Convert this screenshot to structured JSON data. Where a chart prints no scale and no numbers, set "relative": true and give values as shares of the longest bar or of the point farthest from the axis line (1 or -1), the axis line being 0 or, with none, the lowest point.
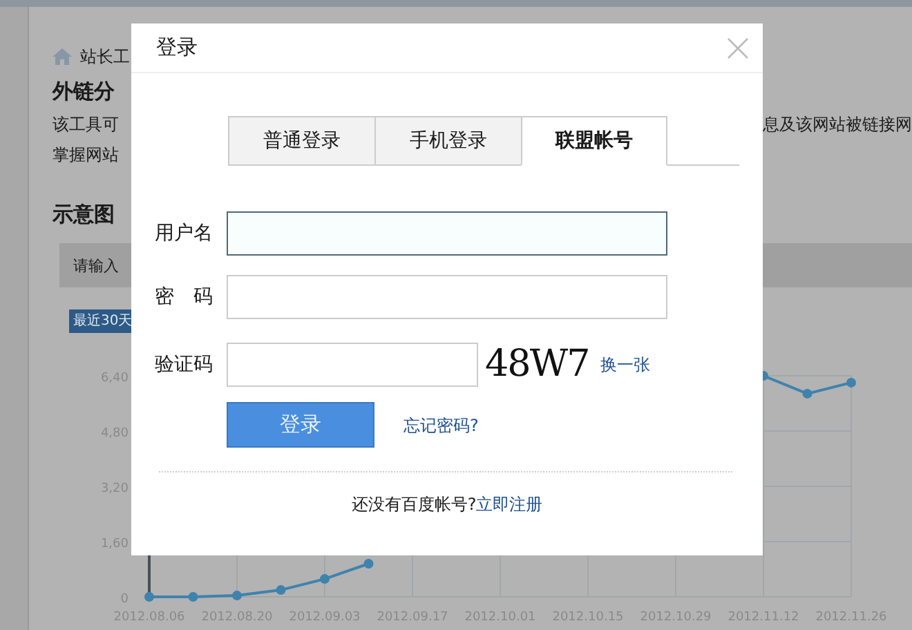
{
  "background": {
    "breadcrumb": "站长工",
    "title": "外链分",
    "description_left": [
      "该工具可",
      "掌握网站"
    ],
    "description_right": "息及该网站被链接网",
    "section_title": "示意图",
    "search_hint": "请输入",
    "range_tab": "最近30天",
    "chart_data": {
      "type": "line",
      "relative": true,
      "categories": [
        "2012.08.06",
        null,
        "2012.08.20",
        null,
        "2012.09.03",
        null,
        "2012.09.17",
        null,
        "2012.10.01",
        null,
        "2012.10.15",
        null,
        "2012.10.29",
        null,
        "2012.11.12",
        null,
        "2012.11.26"
      ],
      "series": [
        {
          "color": "#3f83ad",
          "marker": "circle",
          "values": [
            0,
            0,
            0.006,
            0.031,
            0.081,
            0.15,
            null,
            null,
            null,
            null,
            null,
            null,
            null,
            null,
            1,
            0.919,
            0.969
          ]
        }
      ],
      "grid": true
    },
    "chart_y_labels": [
      "6,40",
      "4,80",
      "3,20",
      "1,60",
      "0"
    ]
  },
  "dialog": {
    "title": "登录",
    "tabs": [
      {
        "label": "普通登录",
        "selected": false
      },
      {
        "label": "手机登录",
        "selected": false
      },
      {
        "label": "联盟帐号",
        "selected": true
      }
    ],
    "fields": [
      {
        "label": "用户名",
        "kind": "text",
        "focused": true
      },
      {
        "label": "密　码",
        "kind": "password",
        "focused": false
      },
      {
        "label": "验证码",
        "kind": "captcha",
        "focused": false
      }
    ],
    "captcha": "48W7",
    "refresh_link": "换一张",
    "login_button": "登录",
    "forgot_link": "忘记密码?",
    "register_prompt": "还没有百度帐号?",
    "register_link": "立即注册"
  }
}
